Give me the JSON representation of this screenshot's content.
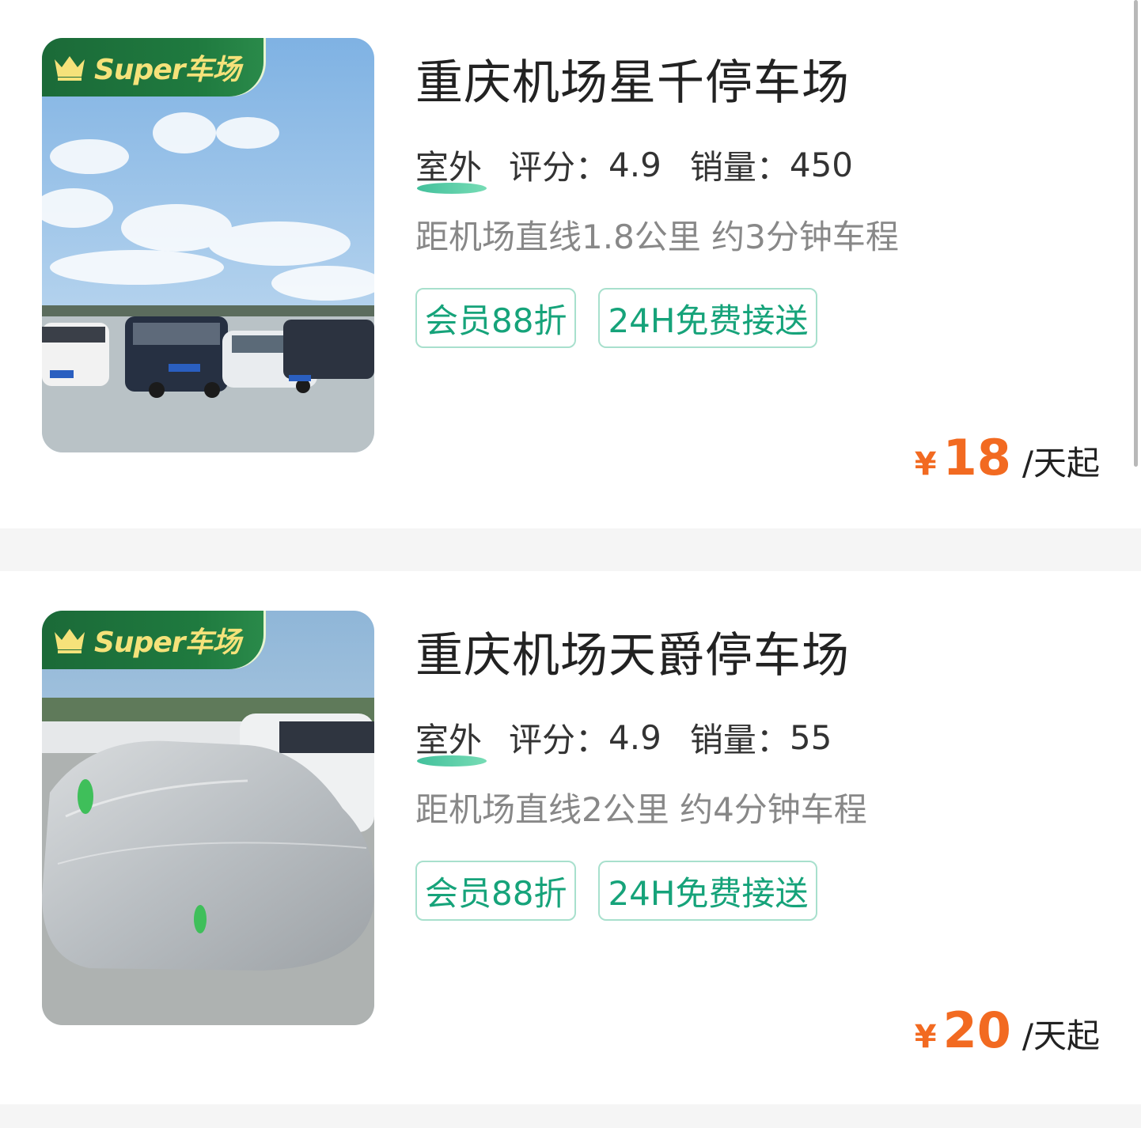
{
  "listings": [
    {
      "badge_text": "Super车场",
      "name": "重庆机场星千停车场",
      "type": "室外",
      "rating_label": "评分：",
      "rating": "4.9",
      "sales_label": "销量：",
      "sales": "450",
      "distance": "距机场直线1.8公里 约3分钟车程",
      "tags": [
        "会员88折",
        "24H免费接送"
      ],
      "currency": "¥",
      "price": "18",
      "price_unit": "/天起"
    },
    {
      "badge_text": "Super车场",
      "name": "重庆机场天爵停车场",
      "type": "室外",
      "rating_label": "评分：",
      "rating": "4.9",
      "sales_label": "销量：",
      "sales": "55",
      "distance": "距机场直线2公里 约4分钟车程",
      "tags": [
        "会员88折",
        "24H免费接送"
      ],
      "currency": "¥",
      "price": "20",
      "price_unit": "/天起"
    }
  ],
  "colors": {
    "accent_green": "#16a37a",
    "badge_green": "#1f7a3f",
    "price_orange": "#f26a21"
  }
}
